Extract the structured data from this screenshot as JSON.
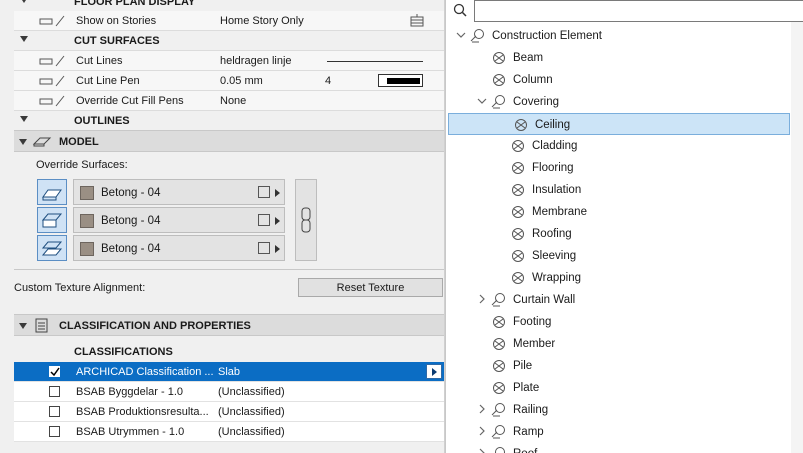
{
  "left": {
    "top_rows": [
      {
        "label": "FLOOR PLAN DISPLAY",
        "value": "",
        "header": true
      },
      {
        "label": "Show on Stories",
        "value": "Home Story Only"
      },
      {
        "label": "CUT SURFACES",
        "value": "",
        "header": true
      },
      {
        "label": "Cut Lines",
        "value": "heldragen linje"
      },
      {
        "label": "Cut Line Pen",
        "value": "0.05 mm",
        "extra": "4"
      },
      {
        "label": "Override Cut Fill Pens",
        "value": "None"
      },
      {
        "label": "OUTLINES",
        "value": "",
        "header": true
      }
    ],
    "model": {
      "title": "MODEL",
      "override_label": "Override Surfaces:",
      "surfaces": [
        "Betong - 04",
        "Betong - 04",
        "Betong - 04"
      ],
      "texture_label": "Custom Texture Alignment:",
      "reset_button": "Reset Texture"
    },
    "classification": {
      "title": "CLASSIFICATION AND PROPERTIES",
      "subheader": "CLASSIFICATIONS",
      "rows": [
        {
          "name": "ARCHICAD Classification ...",
          "value": "Slab",
          "checked": true,
          "selected": true
        },
        {
          "name": "BSAB Byggdelar - 1.0",
          "value": "(Unclassified)",
          "checked": false
        },
        {
          "name": "BSAB Produktionsresulta...",
          "value": "(Unclassified)",
          "checked": false
        },
        {
          "name": "BSAB Utrymmen - 1.0",
          "value": "(Unclassified)",
          "checked": false
        }
      ]
    }
  },
  "right": {
    "search": {
      "placeholder": "",
      "value": ""
    },
    "tree": [
      {
        "label": "Construction Element",
        "level": 0,
        "exp": "open",
        "folder": true
      },
      {
        "label": "Beam",
        "level": 1
      },
      {
        "label": "Column",
        "level": 1
      },
      {
        "label": "Covering",
        "level": 1,
        "exp": "open",
        "folder": true
      },
      {
        "label": "Ceiling",
        "level": 2,
        "selected": true
      },
      {
        "label": "Cladding",
        "level": 2
      },
      {
        "label": "Flooring",
        "level": 2
      },
      {
        "label": "Insulation",
        "level": 2
      },
      {
        "label": "Membrane",
        "level": 2
      },
      {
        "label": "Roofing",
        "level": 2
      },
      {
        "label": "Sleeving",
        "level": 2
      },
      {
        "label": "Wrapping",
        "level": 2
      },
      {
        "label": "Curtain Wall",
        "level": 1,
        "exp": "closed",
        "folder": true
      },
      {
        "label": "Footing",
        "level": 1
      },
      {
        "label": "Member",
        "level": 1
      },
      {
        "label": "Pile",
        "level": 1
      },
      {
        "label": "Plate",
        "level": 1
      },
      {
        "label": "Railing",
        "level": 1,
        "exp": "closed",
        "folder": true
      },
      {
        "label": "Ramp",
        "level": 1,
        "exp": "closed",
        "folder": true
      },
      {
        "label": "Roof",
        "level": 1,
        "exp": "closed",
        "folder": true
      }
    ]
  }
}
